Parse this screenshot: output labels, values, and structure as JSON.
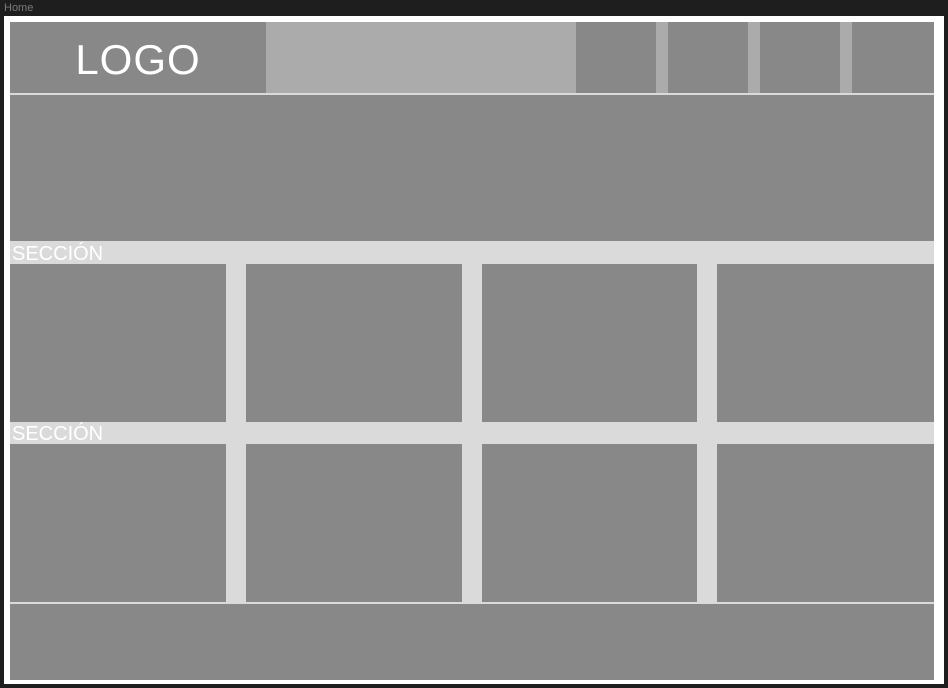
{
  "frame": {
    "label": "Home"
  },
  "header": {
    "logo_text": "LOGO",
    "nav_items": [
      "",
      "",
      "",
      ""
    ]
  },
  "sections": [
    {
      "label": "SECCIÓN",
      "cards": 4
    },
    {
      "label": "SECCIÓN",
      "cards": 4
    }
  ],
  "colors": {
    "block": "#888888",
    "search": "#ababab",
    "gap": "#dadada",
    "canvas": "#ffffff",
    "background": "#1e1e1e"
  }
}
